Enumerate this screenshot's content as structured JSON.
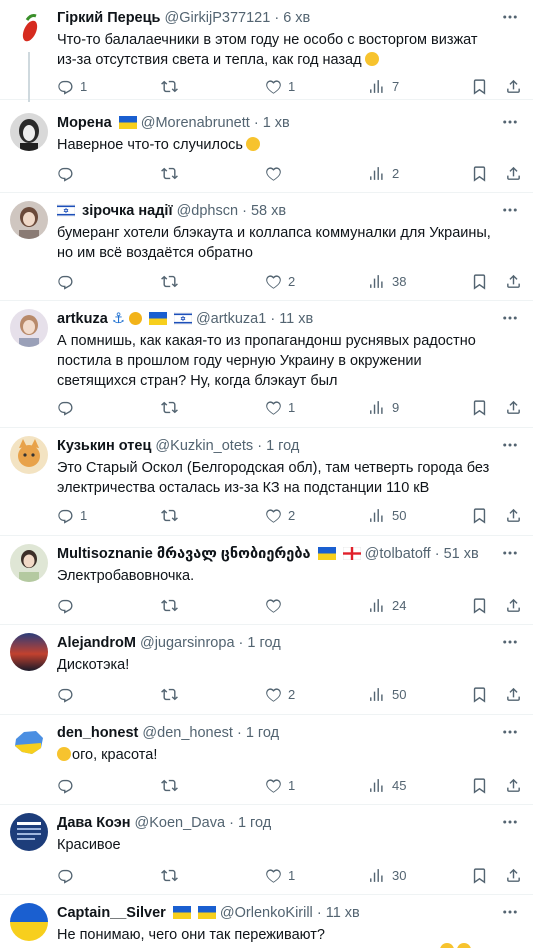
{
  "tweets": [
    {
      "name": "Гіркий Перець",
      "handle": "@GirkijP377121",
      "time": "6 хв",
      "text": "Что-то балалаечники в этом году не особо с восторгом визжат из-за отсутствия света и тепла, как год назад",
      "replies": "1",
      "retweets": "",
      "likes": "1",
      "views": "7"
    },
    {
      "name": "Морена",
      "handle": "@Morenabrunett",
      "time": "1 хв",
      "text": "Наверное что-то случилось",
      "replies": "",
      "retweets": "",
      "likes": "",
      "views": "2"
    },
    {
      "name": "зірочка надії",
      "handle": "@dphscn",
      "time": "58 хв",
      "text": "бумеранг хотели блэкаута и коллапса коммуналки для Украины, но им всё воздаётся обратно",
      "replies": "",
      "retweets": "",
      "likes": "2",
      "views": "38"
    },
    {
      "name": "artkuza",
      "handle": "@artkuza1",
      "time": "11 хв",
      "text": "А помнишь, как какая-то из пропагандонш руснявых радостно постила в прошлом году черную Украину в окружении светящихся стран? Ну, когда блэкаут был",
      "replies": "",
      "retweets": "",
      "likes": "1",
      "views": "9"
    },
    {
      "name": "Кузькин отец",
      "handle": "@Kuzkin_otets",
      "time": "1 год",
      "text": "Это Старый Оскол (Белгородская обл), там четверть города без электричества осталась из-за КЗ на подстанции 110 кВ",
      "replies": "1",
      "retweets": "",
      "likes": "2",
      "views": "50"
    },
    {
      "name": "Multisoznanie მრავალ ცნობიერება",
      "handle": "@tolbatoff",
      "time": "51 хв",
      "text": "Электробавовночка.",
      "replies": "",
      "retweets": "",
      "likes": "",
      "views": "24"
    },
    {
      "name": "AlejandroM",
      "handle": "@jugarsinropa",
      "time": "1 год",
      "text": "Дискотэка!",
      "replies": "",
      "retweets": "",
      "likes": "2",
      "views": "50"
    },
    {
      "name": "den_honest",
      "handle": "@den_honest",
      "time": "1 год",
      "text": "ого, красота!",
      "replies": "",
      "retweets": "",
      "likes": "1",
      "views": "45"
    },
    {
      "name": "Дава Коэн",
      "handle": "@Koen_Dava",
      "time": "1 год",
      "text": "Красивое",
      "replies": "",
      "retweets": "",
      "likes": "1",
      "views": "30"
    },
    {
      "name": "Captain__Silver",
      "handle": "@OrlenkoKirill",
      "time": "11 хв",
      "text": "Не понимаю, чего они так переживают?",
      "replies": "",
      "retweets": "",
      "likes": "",
      "views": ""
    }
  ],
  "separator": "·",
  "colors": {
    "text": "#0f1419",
    "muted": "#536471",
    "border": "#eff3f4"
  },
  "icons": [
    "reply-icon",
    "retweet-icon",
    "like-icon",
    "views-icon",
    "bookmark-icon",
    "share-icon",
    "more-icon"
  ]
}
